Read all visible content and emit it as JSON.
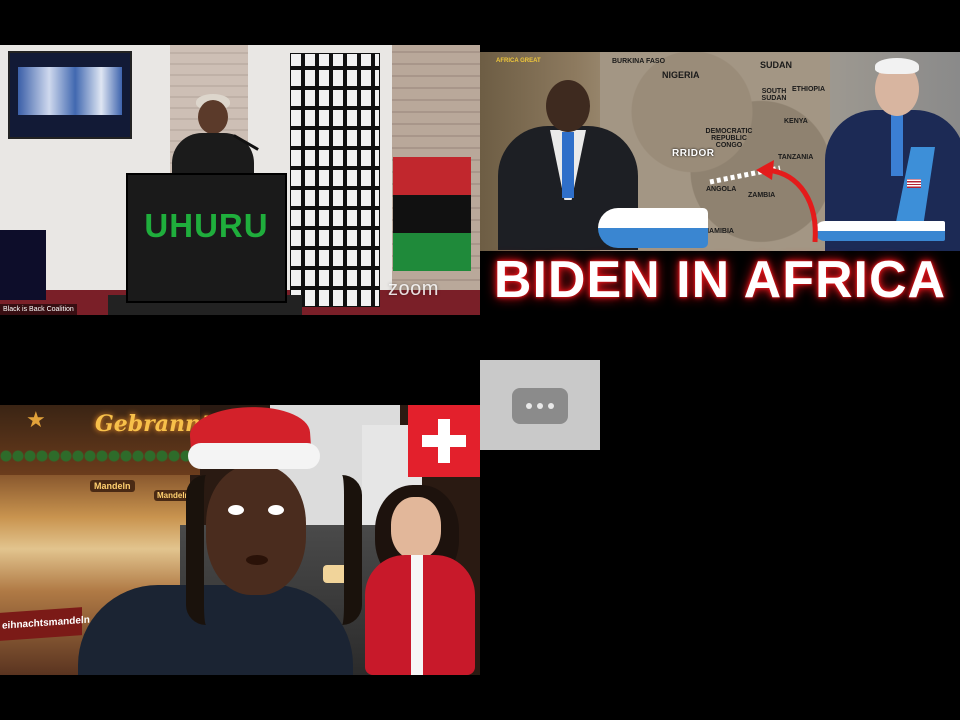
{
  "zoom_tile": {
    "podium_text": "UHURU",
    "participant_name": "Black is Back Coalition",
    "watermark": "zoom",
    "flag_colors": [
      "#c1272d",
      "#111111",
      "#1f8a3a"
    ]
  },
  "news_tile": {
    "headline": "BIDEN IN AFRICA",
    "corridor_label": "RRIDOR",
    "logo_text": "AFRICA GREAT",
    "map_countries": [
      "NIGERIA",
      "SUDAN",
      "SOUTH SUDAN",
      "ETHIOPIA",
      "DEMOCRATIC REPUBLIC CONGO",
      "KENYA",
      "TANZANIA",
      "ANGOLA",
      "ZAMBIA",
      "NAMIBIA",
      "BURKINA FASO"
    ],
    "accent_color": "#e8151b"
  },
  "loading_tile": {
    "icon": "more-horizontal-icon"
  },
  "xmas_tile": {
    "stall_sign": "Gebrannte",
    "counter_sign": "eihnachtsmandeln",
    "side_sign_1": "Mandeln",
    "side_sign_2": "Mandeln",
    "flag": "switzerland-flag-icon"
  }
}
